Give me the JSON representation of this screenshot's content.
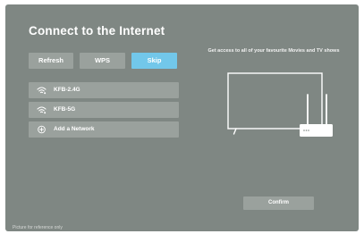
{
  "page": {
    "title": "Connect to the Internet",
    "footnote": "Picture for reference only"
  },
  "colors": {
    "background": "#7f8783",
    "button": "#9aa19d",
    "selected_button": "#72c7ea",
    "text": "#ffffff"
  },
  "actions": {
    "refresh_label": "Refresh",
    "wps_label": "WPS",
    "skip_label": "Skip",
    "selected": "Skip"
  },
  "networks": [
    {
      "label": "KFB-2.4G",
      "icon": "wifi-icon"
    },
    {
      "label": "KFB-5G",
      "icon": "wifi-icon"
    },
    {
      "label": "Add a Network",
      "icon": "plus-circle-icon"
    }
  ],
  "promo": {
    "text": "Get access to all of your favourite Movies and TV shows",
    "illustration": "tv-and-router-illustration"
  },
  "confirm_label": "Confirm"
}
